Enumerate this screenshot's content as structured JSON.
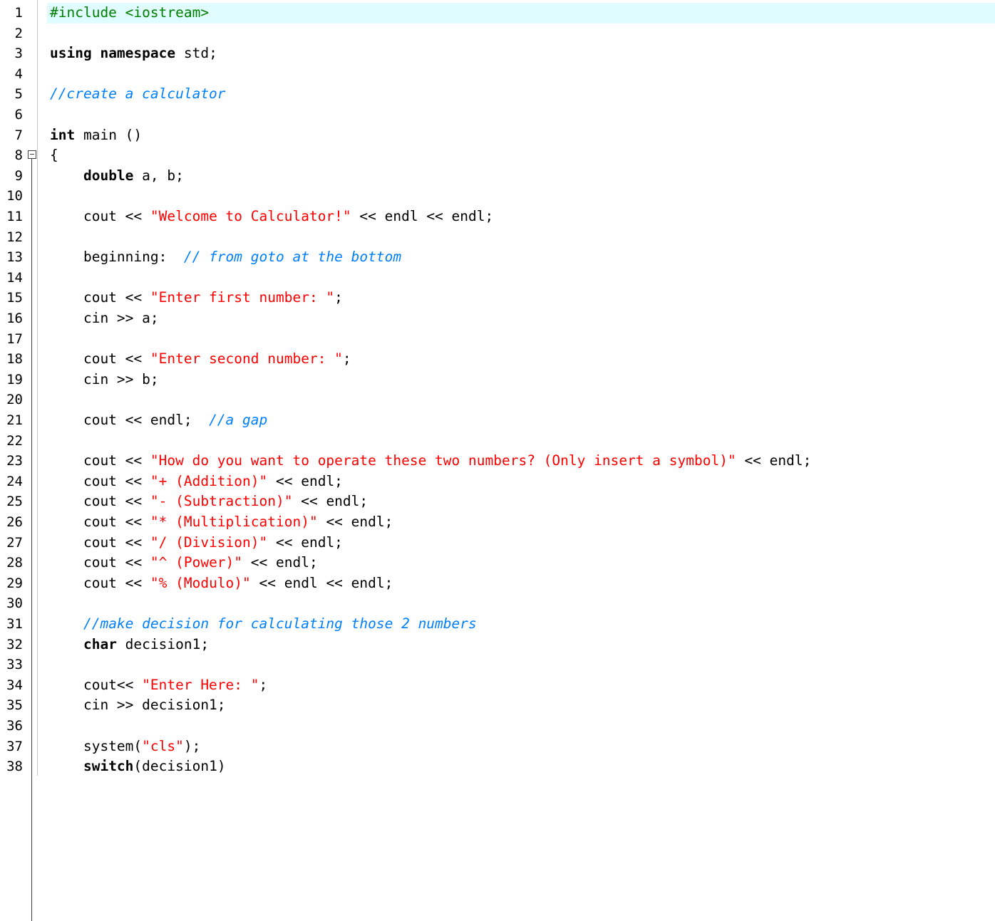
{
  "editor": {
    "current_line": 1,
    "lines": [
      {
        "n": "1",
        "tokens": [
          {
            "t": "#include <iostream>",
            "c": "preproc"
          }
        ]
      },
      {
        "n": "2",
        "tokens": []
      },
      {
        "n": "3",
        "tokens": [
          {
            "t": "using",
            "c": "keyword"
          },
          {
            "t": " ",
            "c": "plain"
          },
          {
            "t": "namespace",
            "c": "keyword"
          },
          {
            "t": " std;",
            "c": "plain"
          }
        ]
      },
      {
        "n": "4",
        "tokens": []
      },
      {
        "n": "5",
        "tokens": [
          {
            "t": "//create a calculator",
            "c": "comment"
          }
        ]
      },
      {
        "n": "6",
        "tokens": []
      },
      {
        "n": "7",
        "tokens": [
          {
            "t": "int",
            "c": "keyword"
          },
          {
            "t": " main ()",
            "c": "plain"
          }
        ]
      },
      {
        "n": "8",
        "fold": true,
        "tokens": [
          {
            "t": "{",
            "c": "plain"
          }
        ]
      },
      {
        "n": "9",
        "tokens": [
          {
            "t": "    ",
            "c": "plain"
          },
          {
            "t": "double",
            "c": "keyword"
          },
          {
            "t": " a, b;",
            "c": "plain"
          }
        ]
      },
      {
        "n": "10",
        "tokens": []
      },
      {
        "n": "11",
        "tokens": [
          {
            "t": "    cout << ",
            "c": "plain"
          },
          {
            "t": "\"Welcome to Calculator!\"",
            "c": "string"
          },
          {
            "t": " << endl << endl;",
            "c": "plain"
          }
        ]
      },
      {
        "n": "12",
        "tokens": []
      },
      {
        "n": "13",
        "tokens": [
          {
            "t": "    beginning:  ",
            "c": "plain"
          },
          {
            "t": "// from goto at the bottom",
            "c": "comment"
          }
        ]
      },
      {
        "n": "14",
        "tokens": []
      },
      {
        "n": "15",
        "tokens": [
          {
            "t": "    cout << ",
            "c": "plain"
          },
          {
            "t": "\"Enter first number: \"",
            "c": "string"
          },
          {
            "t": ";",
            "c": "plain"
          }
        ]
      },
      {
        "n": "16",
        "tokens": [
          {
            "t": "    cin >> a;",
            "c": "plain"
          }
        ]
      },
      {
        "n": "17",
        "tokens": []
      },
      {
        "n": "18",
        "tokens": [
          {
            "t": "    cout << ",
            "c": "plain"
          },
          {
            "t": "\"Enter second number: \"",
            "c": "string"
          },
          {
            "t": ";",
            "c": "plain"
          }
        ]
      },
      {
        "n": "19",
        "tokens": [
          {
            "t": "    cin >> b;",
            "c": "plain"
          }
        ]
      },
      {
        "n": "20",
        "tokens": []
      },
      {
        "n": "21",
        "tokens": [
          {
            "t": "    cout << endl;  ",
            "c": "plain"
          },
          {
            "t": "//a gap",
            "c": "comment"
          }
        ]
      },
      {
        "n": "22",
        "tokens": []
      },
      {
        "n": "23",
        "tokens": [
          {
            "t": "    cout << ",
            "c": "plain"
          },
          {
            "t": "\"How do you want to operate these two numbers? (Only insert a symbol)\"",
            "c": "string"
          },
          {
            "t": " << endl;",
            "c": "plain"
          }
        ]
      },
      {
        "n": "24",
        "tokens": [
          {
            "t": "    cout << ",
            "c": "plain"
          },
          {
            "t": "\"+ (Addition)\"",
            "c": "string"
          },
          {
            "t": " << endl;",
            "c": "plain"
          }
        ]
      },
      {
        "n": "25",
        "tokens": [
          {
            "t": "    cout << ",
            "c": "plain"
          },
          {
            "t": "\"- (Subtraction)\"",
            "c": "string"
          },
          {
            "t": " << endl;",
            "c": "plain"
          }
        ]
      },
      {
        "n": "26",
        "tokens": [
          {
            "t": "    cout << ",
            "c": "plain"
          },
          {
            "t": "\"* (Multiplication)\"",
            "c": "string"
          },
          {
            "t": " << endl;",
            "c": "plain"
          }
        ]
      },
      {
        "n": "27",
        "tokens": [
          {
            "t": "    cout << ",
            "c": "plain"
          },
          {
            "t": "\"/ (Division)\"",
            "c": "string"
          },
          {
            "t": " << endl;",
            "c": "plain"
          }
        ]
      },
      {
        "n": "28",
        "tokens": [
          {
            "t": "    cout << ",
            "c": "plain"
          },
          {
            "t": "\"^ (Power)\"",
            "c": "string"
          },
          {
            "t": " << endl;",
            "c": "plain"
          }
        ]
      },
      {
        "n": "29",
        "tokens": [
          {
            "t": "    cout << ",
            "c": "plain"
          },
          {
            "t": "\"% (Modulo)\"",
            "c": "string"
          },
          {
            "t": " << endl << endl;",
            "c": "plain"
          }
        ]
      },
      {
        "n": "30",
        "tokens": []
      },
      {
        "n": "31",
        "tokens": [
          {
            "t": "    ",
            "c": "plain"
          },
          {
            "t": "//make decision for calculating those 2 numbers",
            "c": "comment"
          }
        ]
      },
      {
        "n": "32",
        "tokens": [
          {
            "t": "    ",
            "c": "plain"
          },
          {
            "t": "char",
            "c": "keyword"
          },
          {
            "t": " decision1;",
            "c": "plain"
          }
        ]
      },
      {
        "n": "33",
        "tokens": []
      },
      {
        "n": "34",
        "tokens": [
          {
            "t": "    cout<< ",
            "c": "plain"
          },
          {
            "t": "\"Enter Here: \"",
            "c": "string"
          },
          {
            "t": ";",
            "c": "plain"
          }
        ]
      },
      {
        "n": "35",
        "tokens": [
          {
            "t": "    cin >> decision1;",
            "c": "plain"
          }
        ]
      },
      {
        "n": "36",
        "tokens": []
      },
      {
        "n": "37",
        "tokens": [
          {
            "t": "    system(",
            "c": "plain"
          },
          {
            "t": "\"cls\"",
            "c": "string"
          },
          {
            "t": ");",
            "c": "plain"
          }
        ]
      },
      {
        "n": "38",
        "tokens": [
          {
            "t": "    ",
            "c": "plain"
          },
          {
            "t": "switch",
            "c": "keyword"
          },
          {
            "t": "(decision1)",
            "c": "plain"
          }
        ]
      }
    ]
  },
  "colors": {
    "keyword": "#000000",
    "preprocessor": "#008000",
    "string": "#ff0000",
    "comment": "#0080ff",
    "current_line_bg": "#e0fcff"
  }
}
